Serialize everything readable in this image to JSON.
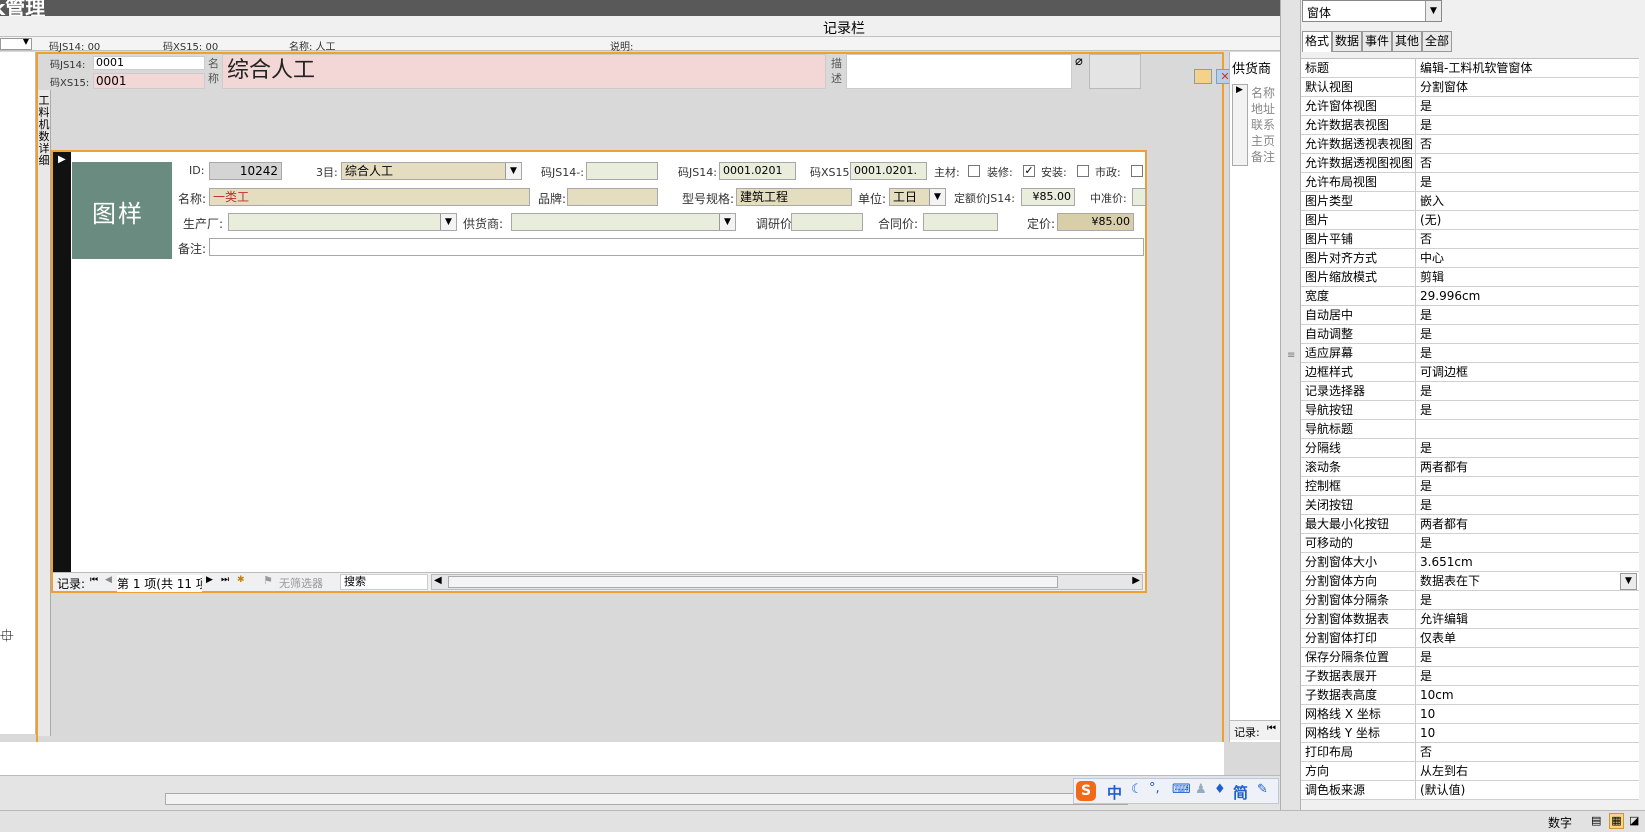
{
  "app": {
    "title_fragment": "k管理"
  },
  "record_bar": {
    "label": "记录栏"
  },
  "header_row": {
    "code14": "码JS14: 00",
    "code15": "码XS15: 00",
    "name": "名称: 人工",
    "desc": "说明:"
  },
  "main_form": {
    "code14_label": "码JS14:",
    "code14_value": "0001",
    "code15_label": "码XS15:",
    "code15_value": "0001",
    "name_label": "名称",
    "name_value": "综合人工",
    "desc_label": "描述",
    "side_label": "工料机数详细",
    "supplier_header": "供货商",
    "supplier_fields": [
      "名称",
      "地址",
      "联系",
      "主页",
      "备注"
    ],
    "right_nav_label": "记录:"
  },
  "subform": {
    "image_text": "图样",
    "id_label": "ID:",
    "id_value": "10242",
    "level3_label": "3目:",
    "level3_value": "综合人工",
    "code14dash_label": "码JS14-:",
    "code14dash_value": "",
    "code14_label": "码JS14:",
    "code14_value": "0001.0201",
    "code15_label": "码XS15:",
    "code15_value": "0001.0201.",
    "main_material_label": "主材:",
    "decor_label": "装修:",
    "install_label": "安装:",
    "municipal_label": "市政:",
    "name_label": "名称:",
    "name_value": "一类工",
    "brand_label": "品牌:",
    "brand_value": "",
    "model_label": "型号规格:",
    "model_value": "建筑工程",
    "unit_label": "单位:",
    "unit_value": "工日",
    "quota_label": "定额价JS14:",
    "quota_value": "¥85.00",
    "mid_label": "中准价:",
    "maker_label": "生产厂:",
    "supplier_label": "供货商:",
    "survey_label": "调研价:",
    "contract_label": "合同价:",
    "price_label": "定价:",
    "price_value": "¥85.00",
    "note_label": "备注:",
    "nav_label": "记录:",
    "nav_position": "第 1 项(共 11 项",
    "filter_label": "无筛选器",
    "search_label": "搜索"
  },
  "ime": {
    "chinese": "中",
    "simplified": "简"
  },
  "status_bar": {
    "mode": "数字"
  },
  "property_sheet": {
    "selector_value": "窗体",
    "tabs": [
      "格式",
      "数据",
      "事件",
      "其他",
      "全部"
    ],
    "rows": [
      {
        "name": "标题",
        "value": "编辑-工料机软管窗体"
      },
      {
        "name": "默认视图",
        "value": "分割窗体"
      },
      {
        "name": "允许窗体视图",
        "value": "是"
      },
      {
        "name": "允许数据表视图",
        "value": "是"
      },
      {
        "name": "允许数据透视表视图",
        "value": "否"
      },
      {
        "name": "允许数据透视图视图",
        "value": "否"
      },
      {
        "name": "允许布局视图",
        "value": "是"
      },
      {
        "name": "图片类型",
        "value": "嵌入"
      },
      {
        "name": "图片",
        "value": "(无)"
      },
      {
        "name": "图片平铺",
        "value": "否"
      },
      {
        "name": "图片对齐方式",
        "value": "中心"
      },
      {
        "name": "图片缩放模式",
        "value": "剪辑"
      },
      {
        "name": "宽度",
        "value": "29.996cm"
      },
      {
        "name": "自动居中",
        "value": "是"
      },
      {
        "name": "自动调整",
        "value": "是"
      },
      {
        "name": "适应屏幕",
        "value": "是"
      },
      {
        "name": "边框样式",
        "value": "可调边框"
      },
      {
        "name": "记录选择器",
        "value": "是"
      },
      {
        "name": "导航按钮",
        "value": "是"
      },
      {
        "name": "导航标题",
        "value": ""
      },
      {
        "name": "分隔线",
        "value": "是"
      },
      {
        "name": "滚动条",
        "value": "两者都有"
      },
      {
        "name": "控制框",
        "value": "是"
      },
      {
        "name": "关闭按钮",
        "value": "是"
      },
      {
        "name": "最大最小化按钮",
        "value": "两者都有"
      },
      {
        "name": "可移动的",
        "value": "是"
      },
      {
        "name": "分割窗体大小",
        "value": "3.651cm"
      },
      {
        "name": "分割窗体方向",
        "value": "数据表在下"
      },
      {
        "name": "分割窗体分隔条",
        "value": "是"
      },
      {
        "name": "分割窗体数据表",
        "value": "允许编辑"
      },
      {
        "name": "分割窗体打印",
        "value": "仅表单"
      },
      {
        "name": "保存分隔条位置",
        "value": "是"
      },
      {
        "name": "子数据表展开",
        "value": "是"
      },
      {
        "name": "子数据表高度",
        "value": "10cm"
      },
      {
        "name": "网格线 X 坐标",
        "value": "10"
      },
      {
        "name": "网格线 Y 坐标",
        "value": "10"
      },
      {
        "name": "打印布局",
        "value": "否"
      },
      {
        "name": "方向",
        "value": "从左到右"
      },
      {
        "name": "调色板来源",
        "value": "(默认值)"
      }
    ]
  }
}
